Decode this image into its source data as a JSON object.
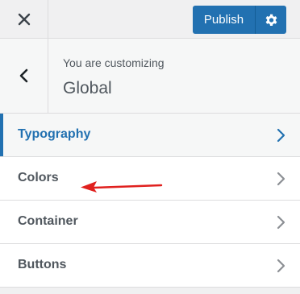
{
  "header": {
    "publish_label": "Publish",
    "accent_color": "#2271b1"
  },
  "section": {
    "customizing_label": "You are customizing",
    "title": "Global"
  },
  "menu": {
    "items": [
      {
        "label": "Typography",
        "active": true
      },
      {
        "label": "Colors",
        "active": false
      },
      {
        "label": "Container",
        "active": false
      },
      {
        "label": "Buttons",
        "active": false
      }
    ]
  },
  "annotation": {
    "arrow_color": "#e0201e"
  }
}
